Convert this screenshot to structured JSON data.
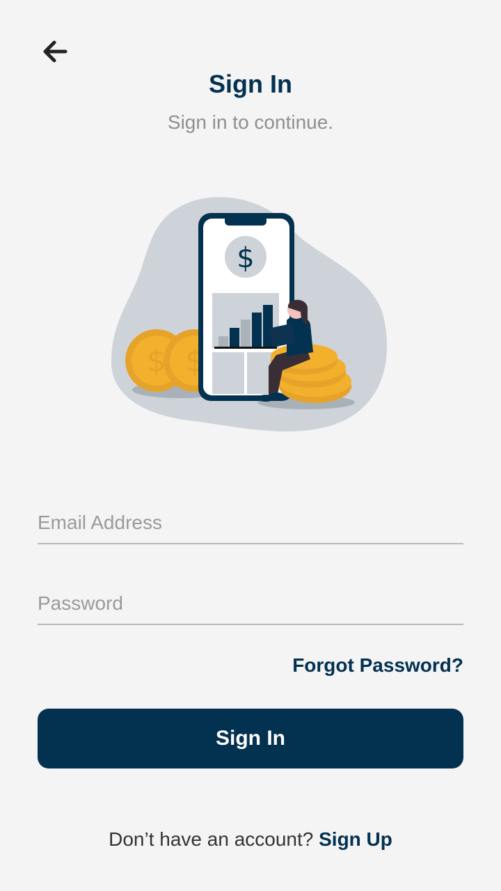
{
  "header": {
    "title": "Sign In",
    "subtitle": "Sign in to continue.",
    "back_icon": "arrow-left-icon"
  },
  "illustration": {
    "phone_symbol": "$",
    "coin_symbol": "$"
  },
  "form": {
    "email_placeholder": "Email Address",
    "email_value": "",
    "password_placeholder": "Password",
    "password_value": "",
    "forgot_label": "Forgot Password?",
    "submit_label": "Sign In"
  },
  "footer": {
    "prompt": "Don’t have an account?",
    "signup_label": "Sign Up"
  },
  "colors": {
    "primary": "#033150",
    "background": "#f4f4f4",
    "coin": "#f2b02c",
    "blob": "#cdd3d8"
  }
}
